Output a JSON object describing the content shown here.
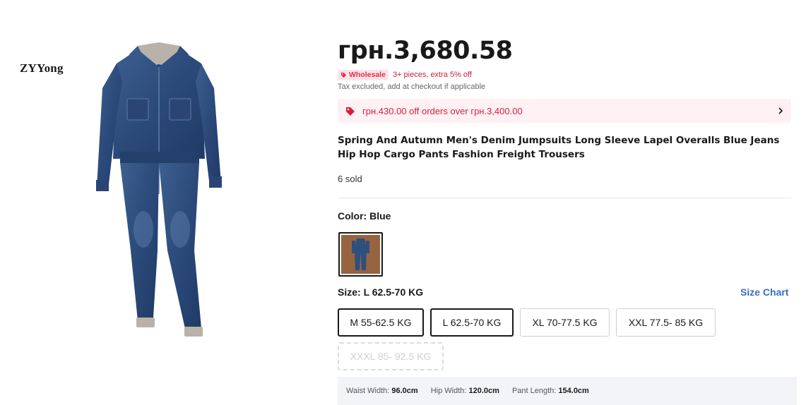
{
  "brand": {
    "mark": "ZYYong"
  },
  "product": {
    "price": "грн.3,680.58",
    "wholesale_badge": "Wholesale",
    "wholesale_note": "3+ pieces, extra 5% off",
    "tax_note": "Tax excluded, add at checkout if applicable",
    "coupon_text": "грн.430.00 off orders over грн.3,400.00",
    "title": "Spring And Autumn Men's Denim Jumpsuits Long Sleeve Lapel Overalls Blue Jeans Hip Hop Cargo Pants Fashion Freight Trousers",
    "sold": "6 sold"
  },
  "color": {
    "label": "Color: Blue",
    "options": [
      {
        "name": "Blue",
        "selected": true
      }
    ]
  },
  "size": {
    "label": "Size: L 62.5-70 KG",
    "chart_link": "Size Chart",
    "options": [
      {
        "label": "M 55-62.5 KG",
        "state": "normal"
      },
      {
        "label": "L 62.5-70 KG",
        "state": "selected"
      },
      {
        "label": "XL 70-77.5 KG",
        "state": "normal"
      },
      {
        "label": "XXL 77.5- 85 KG",
        "state": "normal"
      },
      {
        "label": "XXXL 85- 92.5 KG",
        "state": "disabled"
      }
    ]
  },
  "measurements": {
    "waist_label": "Waist Width:",
    "waist_value": "96.0cm",
    "hip_label": "Hip Width:",
    "hip_value": "120.0cm",
    "length_label": "Pant Length:",
    "length_value": "154.0cm"
  },
  "colors": {
    "accent_red": "#e0304e",
    "coupon_bg": "#fff1f3",
    "link_blue": "#3a6cc7",
    "denim": "#2f4f7f"
  }
}
